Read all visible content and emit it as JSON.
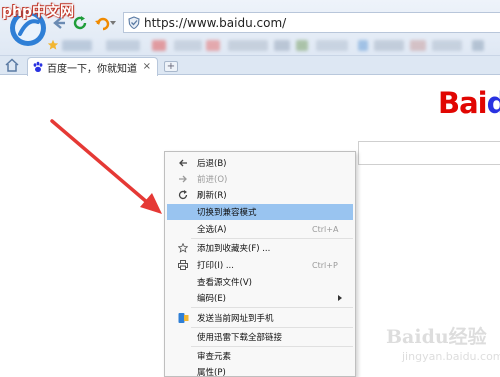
{
  "watermark_top": "php中文网",
  "address_bar": {
    "url": "https://www.baidu.com/"
  },
  "tab": {
    "title": "百度一下，你就知道",
    "close": "×"
  },
  "new_tab": "+",
  "page": {
    "logo_red": "Bai",
    "logo_blue": "d",
    "logo_colors": {
      "red": "#e10602",
      "blue": "#2932e1"
    }
  },
  "context_menu": {
    "items": [
      {
        "icon": "arrow-left-icon",
        "label": "后退(B)",
        "shortcut": "",
        "disabled": false
      },
      {
        "icon": "arrow-right-icon",
        "label": "前进(O)",
        "shortcut": "",
        "disabled": true
      },
      {
        "icon": "refresh-icon",
        "label": "刷新(R)",
        "shortcut": "",
        "disabled": false
      },
      {
        "icon": "",
        "label": "切换到兼容模式",
        "shortcut": "",
        "disabled": false,
        "highlighted": true
      },
      {
        "icon": "",
        "label": "全选(A)",
        "shortcut": "Ctrl+A",
        "disabled": false
      },
      {
        "icon": "star-icon",
        "label": "添加到收藏夹(F) ...",
        "shortcut": "",
        "disabled": false
      },
      {
        "icon": "printer-icon",
        "label": "打印(I) ...",
        "shortcut": "Ctrl+P",
        "disabled": false
      },
      {
        "icon": "",
        "label": "查看源文件(V)",
        "shortcut": "",
        "disabled": false
      },
      {
        "icon": "",
        "label": "编码(E)",
        "shortcut": "",
        "disabled": false,
        "submenu": true
      },
      {
        "icon": "phone-icon",
        "label": "发送当前网址到手机",
        "shortcut": "",
        "disabled": false
      },
      {
        "icon": "",
        "label": "使用迅雷下载全部链接",
        "shortcut": "",
        "disabled": false
      },
      {
        "icon": "",
        "label": "审查元素",
        "shortcut": "",
        "disabled": false
      },
      {
        "icon": "",
        "label": "属性(P)",
        "shortcut": "",
        "disabled": false
      }
    ]
  },
  "watermark_bottom": {
    "main": "Baidu经验",
    "sub": "jingyan.baidu.com"
  },
  "colors": {
    "highlight": "#99c4f0",
    "arrow": "#e53935",
    "accent": "#2f7fd6"
  }
}
